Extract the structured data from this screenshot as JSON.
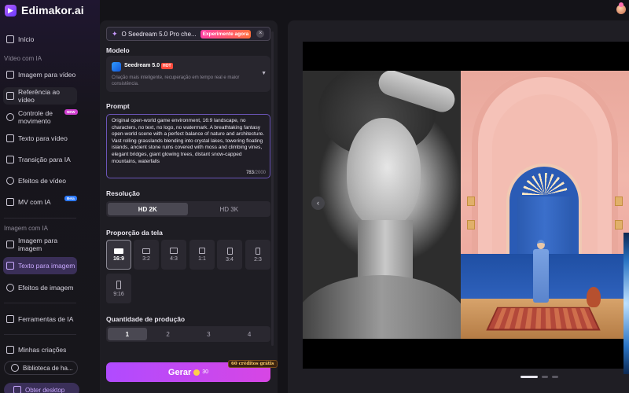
{
  "brand": {
    "name": "Edimakor.ai"
  },
  "sidebar": {
    "home": "Início",
    "section_video": "Vídeo com IA",
    "video_items": [
      {
        "label": "Imagem para vídeo",
        "icon": "image-to-video-icon"
      },
      {
        "label": "Referência ao vídeo",
        "icon": "reference-video-icon"
      },
      {
        "label": "Controle de movimento",
        "icon": "motion-control-icon",
        "badge": "NEW"
      },
      {
        "label": "Texto para vídeo",
        "icon": "text-to-video-icon"
      },
      {
        "label": "Transição para IA",
        "icon": "transition-icon"
      },
      {
        "label": "Efeitos de vídeo",
        "icon": "video-effects-icon"
      },
      {
        "label": "MV com IA",
        "icon": "music-video-icon",
        "badge": "Beta"
      }
    ],
    "section_image": "Imagem com IA",
    "image_items": [
      {
        "label": "Imagem para imagem",
        "icon": "image-to-image-icon"
      },
      {
        "label": "Texto para imagem",
        "icon": "text-to-image-icon"
      },
      {
        "label": "Efeitos de imagem",
        "icon": "image-effects-icon"
      }
    ],
    "tools": "Ferramentas de IA",
    "my_creations": "Minhas criações",
    "library": "Biblioteca de ha...",
    "desktop": "Obter desktop"
  },
  "panel": {
    "promo_text": "O Seedream 5.0 Pro che...",
    "promo_badge": "Experimente agora",
    "model_label": "Modelo",
    "model_name": "Seedream 5.0",
    "model_tag": "HOT",
    "model_desc": "Criação mais inteligente, recuperação em tempo real e maior consistência.",
    "prompt_label": "Prompt",
    "prompt_text": "Original open-world game environment, 16:9 landscape, no characters, no text, no logo, no watermark. A breathtaking fantasy open-world scene with a perfect balance of nature and architecture. Vast rolling grasslands blending into crystal lakes, towering floating islands, ancient stone ruins covered with moss and climbing vines, elegant bridges, giant glowing trees, distant snow-capped mountains, waterfalls",
    "prompt_count": "783",
    "prompt_max": "/2000",
    "resolution_label": "Resolução",
    "resolutions": [
      "HD 2K",
      "HD 3K"
    ],
    "resolution_selected": "HD 2K",
    "ratio_label": "Proporção da tela",
    "ratios": [
      "16:9",
      "3:2",
      "4:3",
      "1:1",
      "3:4",
      "2:3",
      "9:16"
    ],
    "ratio_selected": "16:9",
    "quantity_label": "Quantidade de produção",
    "quantities": [
      "1",
      "2",
      "3",
      "4"
    ],
    "quantity_selected": "1",
    "generate_label": "Gerar",
    "generate_cost": "30",
    "credits_badge": "60 créditos grátis"
  },
  "preview": {
    "slides_total": 3,
    "slide_active": 1
  },
  "colors": {
    "accent": "#b04bff",
    "accent_active_bg": "#3a2f58",
    "hot": "#ff4a3c"
  }
}
